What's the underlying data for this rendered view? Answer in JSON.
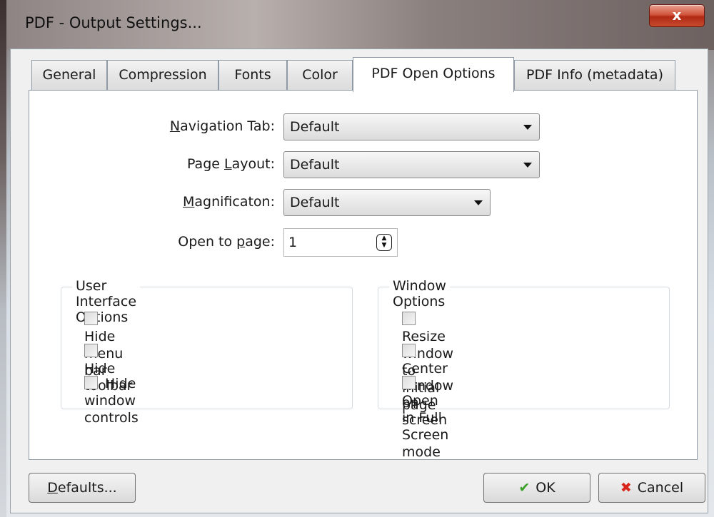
{
  "window": {
    "title": "PDF - Output Settings...",
    "close_glyph": "x"
  },
  "tabs": [
    {
      "label": "General"
    },
    {
      "label": "Compression"
    },
    {
      "label": "Fonts"
    },
    {
      "label": "Color"
    },
    {
      "label": "PDF Open Options",
      "active": true
    },
    {
      "label": "PDF Info (metadata)"
    }
  ],
  "fields": {
    "navigation_tab": {
      "label_mnemonic": "N",
      "label_rest": "avigation Tab:",
      "value": "Default"
    },
    "page_layout": {
      "label_pre": "Page ",
      "label_mnemonic": "L",
      "label_rest": "ayout:",
      "value": "Default"
    },
    "magnification": {
      "label_mnemonic": "M",
      "label_rest": "agnificaton:",
      "value": "Default"
    },
    "open_to_page": {
      "label_pre": "Open to ",
      "label_mnemonic": "p",
      "label_rest": "age:",
      "value": "1"
    }
  },
  "user_interface_options": {
    "title": "User Interface Options",
    "items": [
      {
        "label": "Hide menu bar",
        "checked": false
      },
      {
        "label": "Hide toolbar",
        "checked": false
      },
      {
        "label": "Hide window controls",
        "checked": false
      }
    ]
  },
  "window_options": {
    "title": "Window Options",
    "items": [
      {
        "label": "Resize window to initial page",
        "checked": false
      },
      {
        "label": "Center window on screen",
        "checked": false
      },
      {
        "label": "Open in Full Screen mode",
        "checked": false
      }
    ]
  },
  "buttons": {
    "defaults_mnemonic": "D",
    "defaults_rest": "efaults...",
    "ok": "OK",
    "cancel": "Cancel"
  },
  "colors": {
    "ok_icon": "#3aa02a",
    "cancel_icon": "#d9241b",
    "close_button": "#c84a2f"
  },
  "icons": {
    "ok": "checkmark-icon",
    "cancel": "red-x-icon",
    "spin": "spinner-arrows-icon"
  }
}
